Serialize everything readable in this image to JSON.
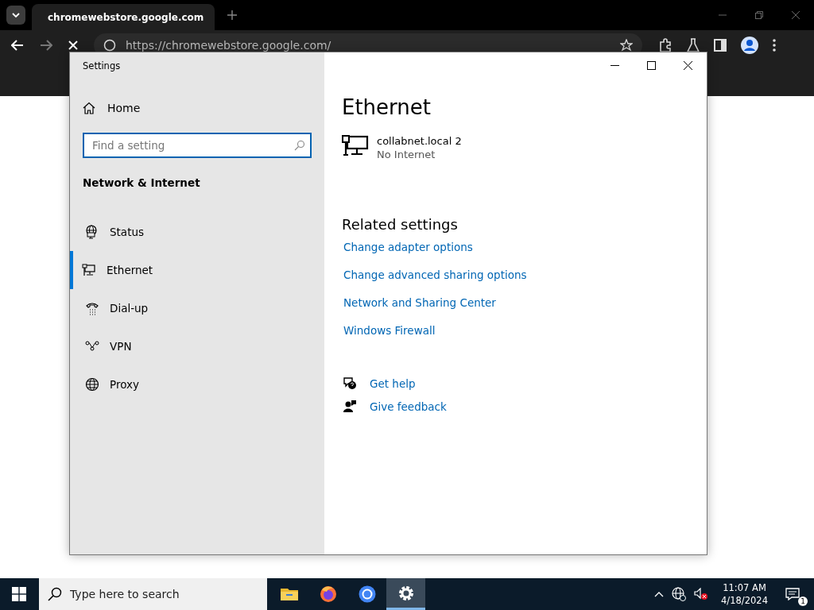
{
  "browser": {
    "tab_title": "chromewebstore.google.com",
    "url": "https://chromewebstore.google.com/"
  },
  "settings_window": {
    "title": "Settings",
    "sidebar": {
      "home": "Home",
      "search": {
        "placeholder": "Find a setting"
      },
      "section": "Network & Internet",
      "items": [
        {
          "label": "Status",
          "kind": "status",
          "selected": false
        },
        {
          "label": "Ethernet",
          "kind": "ethernet",
          "selected": true
        },
        {
          "label": "Dial-up",
          "kind": "dialup",
          "selected": false
        },
        {
          "label": "VPN",
          "kind": "vpn",
          "selected": false
        },
        {
          "label": "Proxy",
          "kind": "proxy",
          "selected": false
        }
      ]
    },
    "main": {
      "heading": "Ethernet",
      "network": {
        "name": "collabnet.local 2",
        "status": "No Internet"
      },
      "related_title": "Related settings",
      "links": [
        "Change adapter options",
        "Change advanced sharing options",
        "Network and Sharing Center",
        "Windows Firewall"
      ],
      "help": [
        {
          "label": "Get help",
          "kind": "help"
        },
        {
          "label": "Give feedback",
          "kind": "feedback"
        }
      ]
    }
  },
  "taskbar": {
    "search": {
      "placeholder": "Type here to search"
    },
    "apps": [
      {
        "kind": "files",
        "selected": false
      },
      {
        "kind": "firefox",
        "selected": false
      },
      {
        "kind": "chrome",
        "selected": false
      },
      {
        "kind": "settings",
        "selected": true
      }
    ],
    "time": "11:07 AM",
    "date": "4/18/2024",
    "notifications": "1"
  }
}
